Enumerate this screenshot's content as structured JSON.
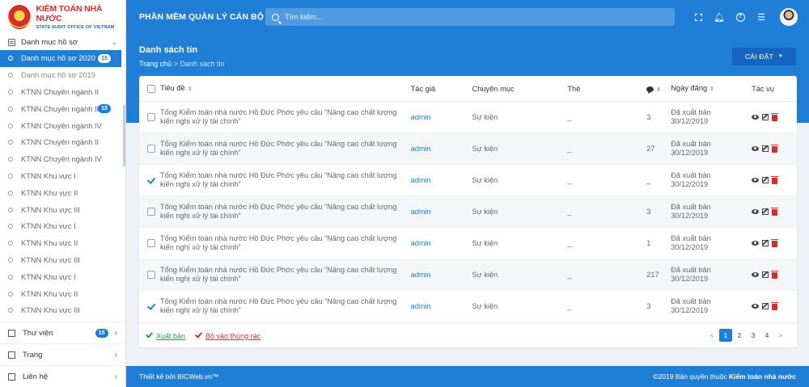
{
  "brand": {
    "name": "KIỂM TOÁN NHÀ NƯỚC",
    "subtitle": "STATE AUDIT OFFICE OF VIETNAM"
  },
  "topbar": {
    "app_title": "PHẦN MỀM QUẢN LÝ CÁN BỘ",
    "search_placeholder": "Tìm kiếm...",
    "icons": [
      "fullscreen-icon",
      "bell-icon",
      "help-icon",
      "list-icon"
    ]
  },
  "sidebar": {
    "group_label": "Danh mục hồ sơ",
    "items": [
      {
        "label": "Danh mục hồ sơ 2020",
        "count": "15",
        "active": true
      },
      {
        "label": "Danh mục hồ sơ 2019"
      },
      {
        "label": "KTNN Chuyên ngành II"
      },
      {
        "label": "KTNN Chuyên ngành III",
        "count": "15"
      },
      {
        "label": "KTNN Chuyên ngành IV"
      },
      {
        "label": "KTNN Chuyên ngành II"
      },
      {
        "label": "KTNN Chuyên ngành IV"
      },
      {
        "label": "KTNN Khu vực I"
      },
      {
        "label": "KTNN Khu vực II"
      },
      {
        "label": "KTNN Khu vực III"
      },
      {
        "label": "KTNN Khu vực I"
      },
      {
        "label": "KTNN Khu vực II"
      },
      {
        "label": "KTNN Khu vực III"
      },
      {
        "label": "KTNN Khu vực I"
      },
      {
        "label": "KTNN Khu vực II"
      },
      {
        "label": "KTNN Khu vực III"
      }
    ],
    "lower": [
      {
        "label": "Thư viện",
        "count": "15"
      },
      {
        "label": "Trang"
      },
      {
        "label": "Liên hệ"
      }
    ]
  },
  "header": {
    "title": "Danh sách tin",
    "breadcrumb_home": "Trang chủ",
    "breadcrumb_sep": " > ",
    "breadcrumb_current": "Danh sách tin",
    "settings_label": "CÀI ĐẶT"
  },
  "table": {
    "columns": {
      "title": "Tiêu đề",
      "author": "Tác giả",
      "category": "Chuyên mục",
      "tag": "Thẻ",
      "date": "Ngày đăng",
      "actions": "Tác vụ"
    },
    "rows": [
      {
        "checked": false,
        "title": "Tổng Kiểm toán nhà nước Hồ Đức Phớc yêu cầu “Nâng cao chất lượng kiến nghị xử lý tài chính”",
        "author": "admin",
        "category": "Sự kiện",
        "tag": "_",
        "comments": "3",
        "status": "Đã xuất bản",
        "date": "30/12/2019"
      },
      {
        "checked": false,
        "title": "Tổng Kiểm toán nhà nước Hồ Đức Phớc yêu cầu “Nâng cao chất lượng kiến nghị xử lý tài chính”",
        "author": "admin",
        "category": "Sự kiện",
        "tag": "_",
        "comments": "27",
        "status": "Đã xuất bản",
        "date": "30/12/2019"
      },
      {
        "checked": true,
        "title": "Tổng Kiểm toán nhà nước Hồ Đức Phớc yêu cầu “Nâng cao chất lượng kiến nghị xử lý tài chính”",
        "author": "admin",
        "category": "Sự kiện",
        "tag": "_",
        "comments": "_",
        "status": "Đã xuất bản",
        "date": "30/12/2019"
      },
      {
        "checked": false,
        "title": "Tổng Kiểm toán nhà nước Hồ Đức Phớc yêu cầu “Nâng cao chất lượng kiến nghị xử lý tài chính”",
        "author": "admin",
        "category": "Sự kiện",
        "tag": "_",
        "comments": "3",
        "status": "Đã xuất bản",
        "date": "30/12/2019"
      },
      {
        "checked": false,
        "title": "Tổng Kiểm toán nhà nước Hồ Đức Phớc yêu cầu “Nâng cao chất lượng kiến nghị xử lý tài chính”",
        "author": "admin",
        "category": "Sự kiện",
        "tag": "_",
        "comments": "1",
        "status": "Đã xuất bản",
        "date": "30/12/2019"
      },
      {
        "checked": false,
        "title": "Tổng Kiểm toán nhà nước Hồ Đức Phớc yêu cầu “Nâng cao chất lượng kiến nghị xử lý tài chính”",
        "author": "admin",
        "category": "Sự kiện",
        "tag": "_",
        "comments": "217",
        "status": "Đã xuất bản",
        "date": "30/12/2019"
      },
      {
        "checked": true,
        "title": "Tổng Kiểm toán nhà nước Hồ Đức Phớc yêu cầu “Nâng cao chất lượng kiến nghị xử lý tài chính”",
        "author": "admin",
        "category": "Sự kiện",
        "tag": "_",
        "comments": "3",
        "status": "Đã xuất bản",
        "date": "30/12/2019"
      }
    ]
  },
  "bulk_actions": {
    "publish": "Xuất bản",
    "trash": "Bỏ vào thùng rác"
  },
  "pagination": {
    "prev": "<",
    "pages": [
      "1",
      "2",
      "3",
      "4"
    ],
    "current": "1",
    "next": ">"
  },
  "footer": {
    "left": "Thiết kế bởi BICWeb.vn™",
    "right_prefix": "©2019 Bản quyền thuộc ",
    "right_bold": "Kiểm toán nhà nước"
  },
  "colors": {
    "primary": "#1f7fd6",
    "danger": "#d32f2f",
    "success": "#2e9e44"
  }
}
